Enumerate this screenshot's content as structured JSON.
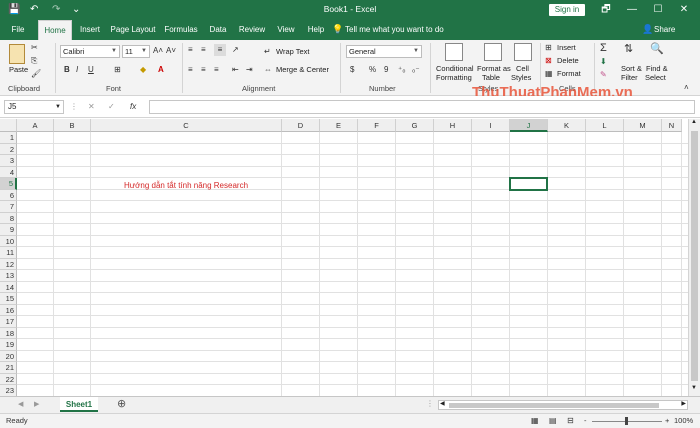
{
  "titlebar": {
    "title": "Book1  -  Excel",
    "sign_in": "Sign in",
    "save_icon": "💾",
    "undo_icon": "↶",
    "redo_icon": "↷",
    "custom_icon": "⌄",
    "restore_icon": "🗗",
    "minimize_icon": "—",
    "maximize_icon": "☐",
    "close_icon": "✕"
  },
  "tabs": [
    {
      "label": "File"
    },
    {
      "label": "Home"
    },
    {
      "label": "Insert"
    },
    {
      "label": "Page Layout"
    },
    {
      "label": "Formulas"
    },
    {
      "label": "Data"
    },
    {
      "label": "Review"
    },
    {
      "label": "View"
    },
    {
      "label": "Help"
    }
  ],
  "tell_me": "Tell me what you want to do",
  "share": "Share",
  "ribbon": {
    "clipboard": {
      "paste": "Paste",
      "label": "Clipboard"
    },
    "font": {
      "name": "Calibri",
      "size": "11",
      "label": "Font",
      "bold": "B",
      "italic": "I",
      "underline": "U"
    },
    "alignment": {
      "wrap": "Wrap Text",
      "merge": "Merge & Center",
      "label": "Alignment"
    },
    "number": {
      "format": "General",
      "currency": "$",
      "percent": "%",
      "comma": "9",
      "label": "Number"
    },
    "styles": {
      "conditional1": "Conditional",
      "conditional2": "Formatting",
      "format_table1": "Format as",
      "format_table2": "Table",
      "cell_styles1": "Cell",
      "cell_styles2": "Styles",
      "label": "Styles"
    },
    "cells": {
      "insert": "Insert",
      "delete": "Delete",
      "format": "Format",
      "label": "Cells"
    },
    "editing": {
      "sort1": "Sort &",
      "sort2": "Filter",
      "find1": "Find &",
      "find2": "Select",
      "label": "Editing"
    }
  },
  "formula_bar": {
    "name_box": "J5",
    "cancel": "✕",
    "enter": "✓",
    "fx": "fx",
    "value": ""
  },
  "grid": {
    "columns": [
      "A",
      "B",
      "C",
      "D",
      "E",
      "F",
      "G",
      "H",
      "I",
      "J",
      "K",
      "L",
      "M",
      "N"
    ],
    "rows": [
      "1",
      "2",
      "3",
      "4",
      "5",
      "6",
      "7",
      "8",
      "9",
      "10",
      "11",
      "12",
      "13",
      "14",
      "15",
      "16",
      "17",
      "18",
      "19",
      "20",
      "21",
      "22",
      "23"
    ],
    "c5_text": "Hướng dẫn tắt tính năng Research"
  },
  "sheets": [
    {
      "name": "Sheet1"
    }
  ],
  "add_sheet": "⊕",
  "status": {
    "ready": "Ready",
    "zoom": "100%",
    "zoom_minus": "-",
    "zoom_plus": "+"
  },
  "watermark": "ThuThuatPhanMem.vn",
  "colors": {
    "accent": "#217346",
    "text_red": "#d42a2a"
  }
}
